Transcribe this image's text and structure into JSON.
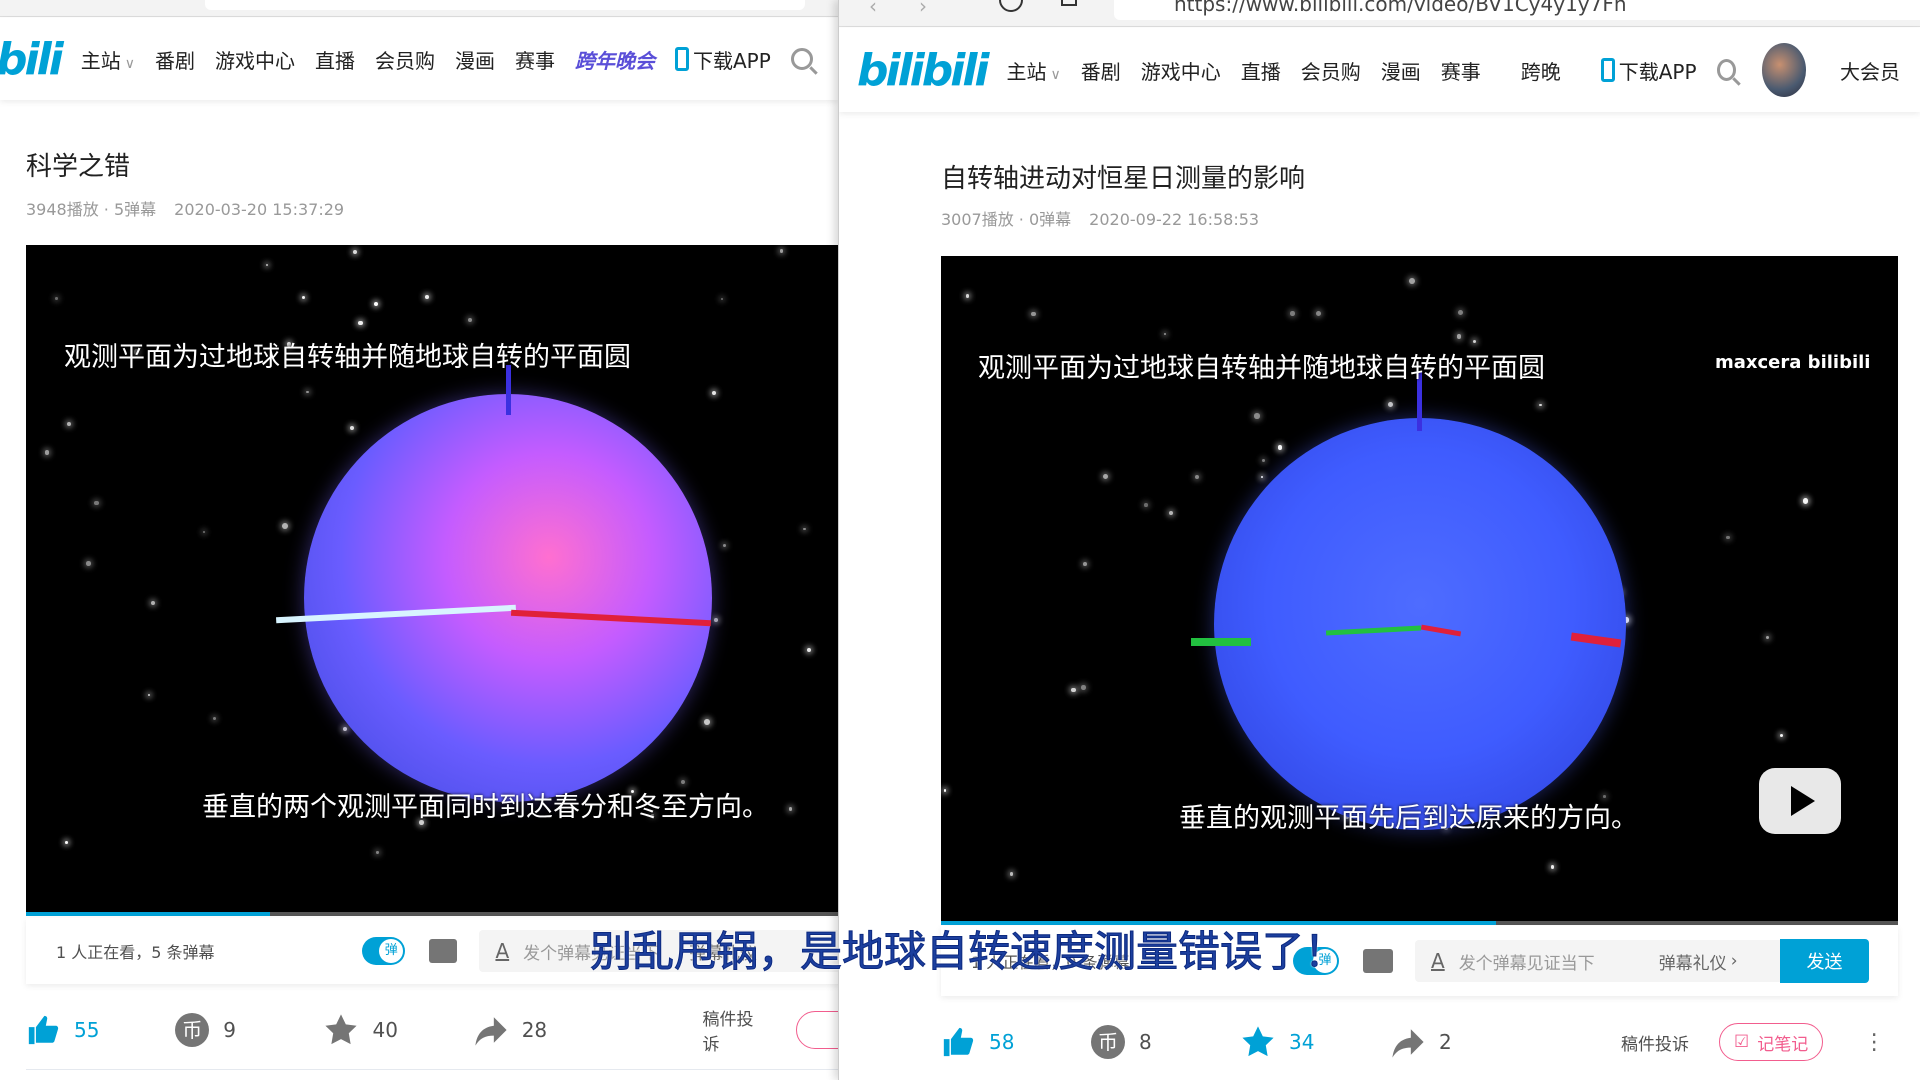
{
  "left": {
    "nav": {
      "logo": "bili",
      "items": [
        "主站",
        "番剧",
        "游戏中心",
        "直播",
        "会员购",
        "漫画",
        "赛事"
      ],
      "special": "跨年晚会",
      "download": "下载APP"
    },
    "title": "科学之错",
    "meta": {
      "views": "3948播放 · 5弹幕",
      "date": "2020-03-20 15:37:29"
    },
    "video": {
      "subtitle_top": "观测平面为过地球自转轴并随地球自转的平面圆",
      "subtitle_bottom": "垂直的两个观测平面同时到达春分和冬至方向。",
      "progress_percent": 30
    },
    "danmaku": {
      "viewers": "1 人正在看，5 条弹幕",
      "toggle": "弹",
      "placeholder": "发个弹幕见证当下",
      "etiquette": "弹幕礼仪"
    },
    "actions": {
      "like": "55",
      "coin": "9",
      "favorite": "40",
      "share": "28",
      "report": "稿件投诉"
    }
  },
  "right": {
    "url": "https://www.bilibili.com/video/BV1Cy4y1y7Fh",
    "nav": {
      "logo": "bilibili",
      "items": [
        "主站",
        "番剧",
        "游戏中心",
        "直播",
        "会员购",
        "漫画",
        "赛事",
        "跨晚"
      ],
      "download": "下载APP",
      "member": "大会员"
    },
    "title": "自转轴进动对恒星日测量的影响",
    "meta": {
      "views": "3007播放 · 0弹幕",
      "date": "2020-09-22 16:58:53"
    },
    "video": {
      "subtitle_top": "观测平面为过地球自转轴并随地球自转的平面圆",
      "subtitle_bottom": "垂直的观测平面先后到达原来的方向。",
      "watermark": "maxcera bilibili",
      "progress_percent": 58
    },
    "danmaku": {
      "viewers": "1 人正在看，0 条弹幕",
      "toggle": "弹",
      "placeholder": "发个弹幕见证当下",
      "etiquette": "弹幕礼仪",
      "send": "发送"
    },
    "actions": {
      "like": "58",
      "coin": "8",
      "favorite": "34",
      "share": "2",
      "report": "稿件投诉",
      "note": "记笔记"
    }
  },
  "overlay_caption": "别乱甩锅，是地球自转速度测量错误了！",
  "colors": {
    "accent": "#00a1d6",
    "pink": "#f25d8e",
    "caption": "#1c3f9e"
  }
}
